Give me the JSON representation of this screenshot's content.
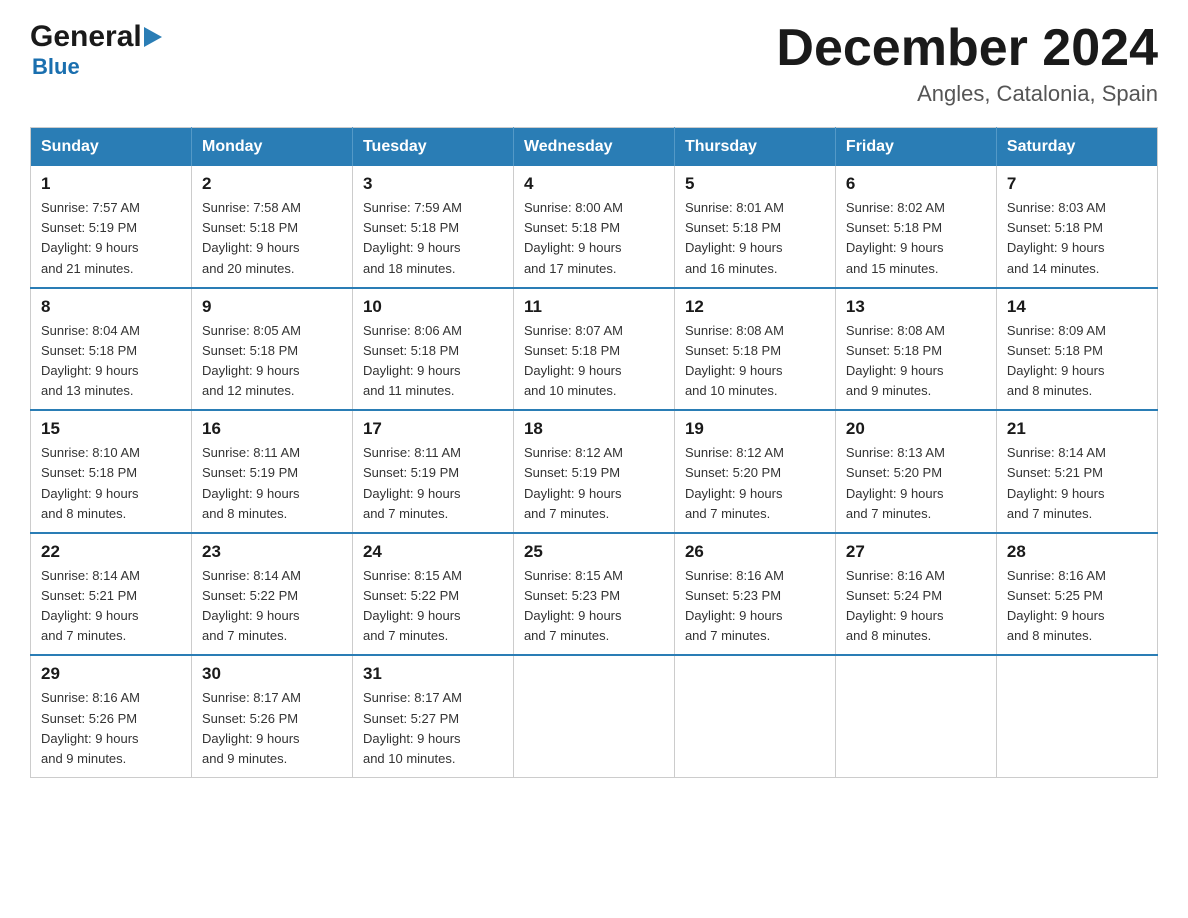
{
  "header": {
    "logo": {
      "general": "General",
      "blue": "Blue",
      "triangle": "▶"
    },
    "title": "December 2024",
    "subtitle": "Angles, Catalonia, Spain"
  },
  "weekdays": [
    "Sunday",
    "Monday",
    "Tuesday",
    "Wednesday",
    "Thursday",
    "Friday",
    "Saturday"
  ],
  "weeks": [
    [
      {
        "day": "1",
        "sunrise": "7:57 AM",
        "sunset": "5:19 PM",
        "daylight": "9 hours and 21 minutes."
      },
      {
        "day": "2",
        "sunrise": "7:58 AM",
        "sunset": "5:18 PM",
        "daylight": "9 hours and 20 minutes."
      },
      {
        "day": "3",
        "sunrise": "7:59 AM",
        "sunset": "5:18 PM",
        "daylight": "9 hours and 18 minutes."
      },
      {
        "day": "4",
        "sunrise": "8:00 AM",
        "sunset": "5:18 PM",
        "daylight": "9 hours and 17 minutes."
      },
      {
        "day": "5",
        "sunrise": "8:01 AM",
        "sunset": "5:18 PM",
        "daylight": "9 hours and 16 minutes."
      },
      {
        "day": "6",
        "sunrise": "8:02 AM",
        "sunset": "5:18 PM",
        "daylight": "9 hours and 15 minutes."
      },
      {
        "day": "7",
        "sunrise": "8:03 AM",
        "sunset": "5:18 PM",
        "daylight": "9 hours and 14 minutes."
      }
    ],
    [
      {
        "day": "8",
        "sunrise": "8:04 AM",
        "sunset": "5:18 PM",
        "daylight": "9 hours and 13 minutes."
      },
      {
        "day": "9",
        "sunrise": "8:05 AM",
        "sunset": "5:18 PM",
        "daylight": "9 hours and 12 minutes."
      },
      {
        "day": "10",
        "sunrise": "8:06 AM",
        "sunset": "5:18 PM",
        "daylight": "9 hours and 11 minutes."
      },
      {
        "day": "11",
        "sunrise": "8:07 AM",
        "sunset": "5:18 PM",
        "daylight": "9 hours and 10 minutes."
      },
      {
        "day": "12",
        "sunrise": "8:08 AM",
        "sunset": "5:18 PM",
        "daylight": "9 hours and 10 minutes."
      },
      {
        "day": "13",
        "sunrise": "8:08 AM",
        "sunset": "5:18 PM",
        "daylight": "9 hours and 9 minutes."
      },
      {
        "day": "14",
        "sunrise": "8:09 AM",
        "sunset": "5:18 PM",
        "daylight": "9 hours and 8 minutes."
      }
    ],
    [
      {
        "day": "15",
        "sunrise": "8:10 AM",
        "sunset": "5:18 PM",
        "daylight": "9 hours and 8 minutes."
      },
      {
        "day": "16",
        "sunrise": "8:11 AM",
        "sunset": "5:19 PM",
        "daylight": "9 hours and 8 minutes."
      },
      {
        "day": "17",
        "sunrise": "8:11 AM",
        "sunset": "5:19 PM",
        "daylight": "9 hours and 7 minutes."
      },
      {
        "day": "18",
        "sunrise": "8:12 AM",
        "sunset": "5:19 PM",
        "daylight": "9 hours and 7 minutes."
      },
      {
        "day": "19",
        "sunrise": "8:12 AM",
        "sunset": "5:20 PM",
        "daylight": "9 hours and 7 minutes."
      },
      {
        "day": "20",
        "sunrise": "8:13 AM",
        "sunset": "5:20 PM",
        "daylight": "9 hours and 7 minutes."
      },
      {
        "day": "21",
        "sunrise": "8:14 AM",
        "sunset": "5:21 PM",
        "daylight": "9 hours and 7 minutes."
      }
    ],
    [
      {
        "day": "22",
        "sunrise": "8:14 AM",
        "sunset": "5:21 PM",
        "daylight": "9 hours and 7 minutes."
      },
      {
        "day": "23",
        "sunrise": "8:14 AM",
        "sunset": "5:22 PM",
        "daylight": "9 hours and 7 minutes."
      },
      {
        "day": "24",
        "sunrise": "8:15 AM",
        "sunset": "5:22 PM",
        "daylight": "9 hours and 7 minutes."
      },
      {
        "day": "25",
        "sunrise": "8:15 AM",
        "sunset": "5:23 PM",
        "daylight": "9 hours and 7 minutes."
      },
      {
        "day": "26",
        "sunrise": "8:16 AM",
        "sunset": "5:23 PM",
        "daylight": "9 hours and 7 minutes."
      },
      {
        "day": "27",
        "sunrise": "8:16 AM",
        "sunset": "5:24 PM",
        "daylight": "9 hours and 8 minutes."
      },
      {
        "day": "28",
        "sunrise": "8:16 AM",
        "sunset": "5:25 PM",
        "daylight": "9 hours and 8 minutes."
      }
    ],
    [
      {
        "day": "29",
        "sunrise": "8:16 AM",
        "sunset": "5:26 PM",
        "daylight": "9 hours and 9 minutes."
      },
      {
        "day": "30",
        "sunrise": "8:17 AM",
        "sunset": "5:26 PM",
        "daylight": "9 hours and 9 minutes."
      },
      {
        "day": "31",
        "sunrise": "8:17 AM",
        "sunset": "5:27 PM",
        "daylight": "9 hours and 10 minutes."
      },
      null,
      null,
      null,
      null
    ]
  ],
  "labels": {
    "sunrise_prefix": "Sunrise: ",
    "sunset_prefix": "Sunset: ",
    "daylight_prefix": "Daylight: "
  }
}
